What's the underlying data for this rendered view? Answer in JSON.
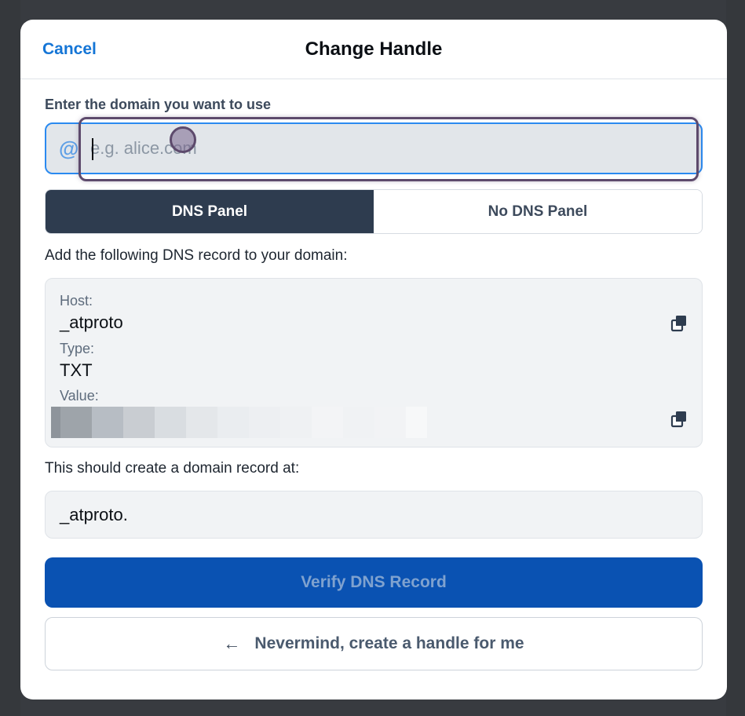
{
  "header": {
    "cancel_label": "Cancel",
    "title": "Change Handle"
  },
  "domain_field": {
    "label": "Enter the domain you want to use",
    "at_symbol": "@",
    "placeholder": "e.g. alice.com",
    "value": ""
  },
  "tabs": [
    {
      "label": "DNS Panel",
      "active": true
    },
    {
      "label": "No DNS Panel",
      "active": false
    }
  ],
  "instruction": "Add the following DNS record to your domain:",
  "dns_record": {
    "host_label": "Host:",
    "host_value": "_atproto",
    "type_label": "Type:",
    "type_value": "TXT",
    "value_label": "Value:"
  },
  "domain_note": "This should create a domain record at:",
  "domain_record": "_atproto.",
  "verify_button": "Verify DNS Record",
  "nevermind_button": "Nevermind, create a handle for me",
  "icons": {
    "copy": "copy-icon",
    "arrow": "arrow-left-icon"
  },
  "colors": {
    "accent": "#1475d6",
    "tab_active_bg": "#2e3c4f",
    "primary_button": "#0a52b2"
  }
}
